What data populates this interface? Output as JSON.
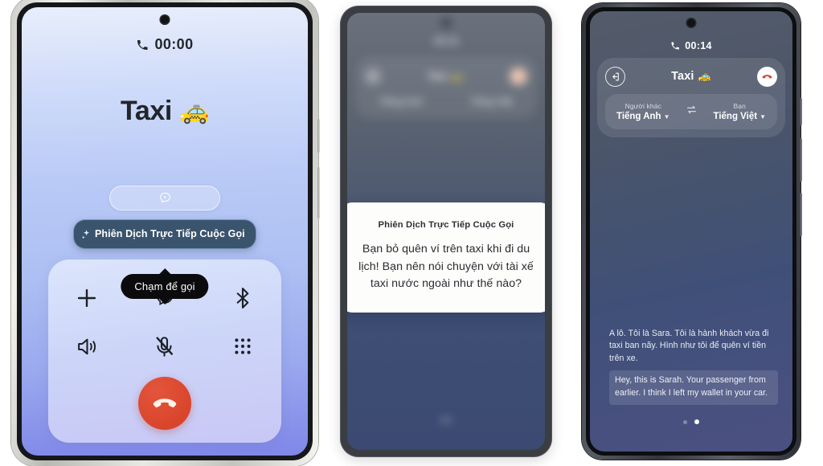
{
  "left_phone": {
    "call_timer": "00:00",
    "contact_name": "Taxi",
    "contact_emoji": "🚕",
    "translate_pill_icon": "live-translate-icon",
    "ai_tooltip": "Phiên Dịch Trực Tiếp Cuộc Gọi",
    "tap_tooltip": "Chạm để gọi",
    "controls": [
      {
        "name": "add-call-button",
        "icon": "plus-icon"
      },
      {
        "name": "live-translate-button",
        "icon": "translate-bubble-icon"
      },
      {
        "name": "bluetooth-button",
        "icon": "bluetooth-icon"
      },
      {
        "name": "speaker-button",
        "icon": "speaker-icon"
      },
      {
        "name": "mute-button",
        "icon": "mic-muted-icon"
      },
      {
        "name": "keypad-button",
        "icon": "dialpad-icon"
      }
    ],
    "hangup": {
      "name": "end-call-button",
      "icon": "hangup-icon",
      "color": "#d9452b"
    }
  },
  "middle_phone": {
    "blurred_background": {
      "call_timer": "00:14",
      "title": "Taxi 🚕",
      "lang_left": "Tiếng Anh",
      "lang_right": "Tiếng Việt"
    },
    "card": {
      "title": "Phiên Dịch Trực Tiếp Cuộc Gọi",
      "body": "Bạn bỏ quên ví trên taxi khi đi du lịch! Bạn nên nói chuyện với tài xế taxi nước ngoài như thế nào?"
    }
  },
  "right_phone": {
    "call_timer": "00:14",
    "header": {
      "back_icon": "exit-app-icon",
      "title": "Taxi",
      "title_emoji": "🚕",
      "hangup_icon": "hangup-icon"
    },
    "languages": {
      "other_label": "Người khác",
      "other_value": "Tiếng Anh",
      "swap_icon": "swap-languages-icon",
      "you_label": "Bạn",
      "you_value": "Tiếng Việt"
    },
    "messages": {
      "translated": "A lô. Tôi là Sara. Tôi là hành khách vừa đi taxi ban nãy. Hình như tôi để quên ví tiền trên xe.",
      "original": "Hey, this is Sarah. Your passenger from earlier. I think I left my wallet in your car."
    },
    "pager": {
      "total": 2,
      "active": 2
    }
  },
  "colors": {
    "hangup_red": "#d9452b",
    "ai_tip_bg": "#3b546e",
    "tap_tip_bg": "#0b0b0d"
  }
}
